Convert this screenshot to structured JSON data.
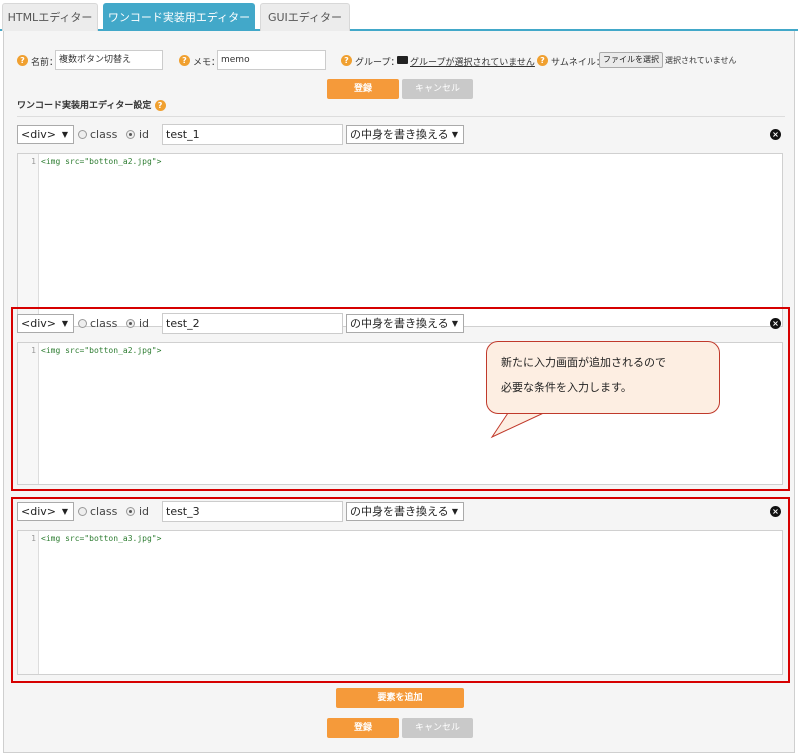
{
  "tabs": [
    "HTMLエディター",
    "ワンコード実装用エディター",
    "GUIエディター"
  ],
  "form": {
    "name_label": "名前：",
    "name_value": "複数ボタン切替え",
    "memo_label": "メモ：",
    "memo_value": "memo",
    "group_label": "グループ：",
    "group_value": "グループが選択されていません",
    "thumb_label": "サムネイル：",
    "file_button": "ファイルを選択",
    "file_status": "選択されていません",
    "help_icon": "?"
  },
  "buttons": {
    "register": "登録",
    "cancel": "キャンセル",
    "add_element": "要素を追加"
  },
  "section_title": "ワンコード実装用エディター設定",
  "editors": [
    {
      "tag": "<div>",
      "class_label": "class",
      "id_label": "id",
      "selected": "id",
      "id_value": "test_1",
      "action": "の中身を書き換える",
      "line_no": "1",
      "code": "<img src=\"botton_a2.jpg\">"
    },
    {
      "tag": "<div>",
      "class_label": "class",
      "id_label": "id",
      "selected": "id",
      "id_value": "test_2",
      "action": "の中身を書き換える",
      "line_no": "1",
      "code": "<img src=\"botton_a2.jpg\">"
    },
    {
      "tag": "<div>",
      "class_label": "class",
      "id_label": "id",
      "selected": "id",
      "id_value": "test_3",
      "action": "の中身を書き換える",
      "line_no": "1",
      "code": "<img src=\"botton_a3.jpg\">"
    }
  ],
  "callout": {
    "line1": "新たに入力画面が追加されるので",
    "line2": "必要な条件を入力します。"
  },
  "icons": {
    "help": "question-circle-icon",
    "folder": "folder-icon",
    "close": "close-circle-icon",
    "dropdown": "chevron-down-icon"
  },
  "colors": {
    "tab_active": "#42a8c9",
    "primary_button": "#f59a3a",
    "highlight_border": "#d60000",
    "callout_bg": "#fdeee2"
  }
}
